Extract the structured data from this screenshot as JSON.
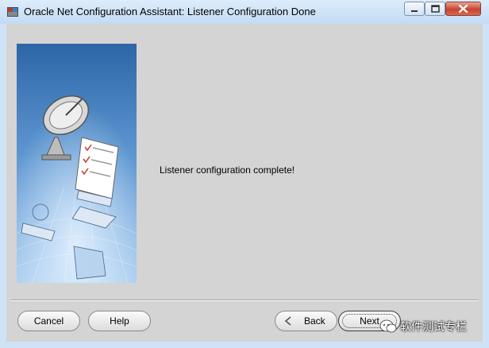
{
  "window": {
    "title": "Oracle Net Configuration Assistant: Listener Configuration Done"
  },
  "main": {
    "message": "Listener configuration complete!"
  },
  "buttons": {
    "cancel": "Cancel",
    "help": "Help",
    "back": "Back",
    "next": "Next"
  },
  "watermark": {
    "text": "软件测试专栏"
  },
  "icons": [
    "oracle-app-icon",
    "minimize-icon",
    "maximize-icon",
    "close-icon",
    "back-arrow-icon",
    "wechat-logo"
  ]
}
